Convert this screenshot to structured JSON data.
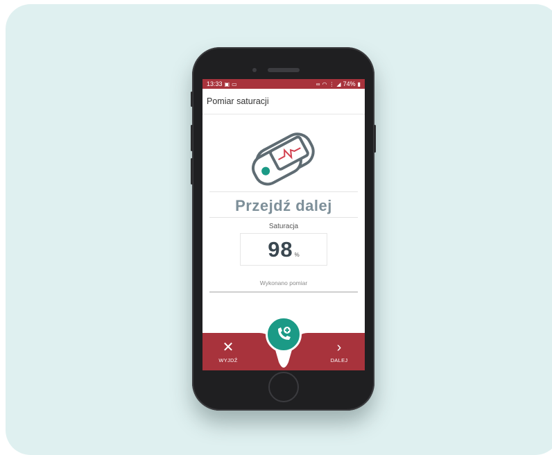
{
  "status_bar": {
    "time": "13:33",
    "icons_left": [
      "image-icon",
      "message-icon"
    ],
    "icons_right": [
      "link-icon",
      "wifi-icon",
      "lte-icon",
      "signal-icon"
    ],
    "battery": "74%"
  },
  "app_bar": {
    "title": "Pomiar saturacji"
  },
  "main": {
    "device_icon": "pulse-oximeter-icon",
    "next_title": "Przejdź dalej",
    "saturation_label": "Saturacja",
    "saturation_value": "98",
    "saturation_unit": "%",
    "status_text": "Wykonano pomiar"
  },
  "bottom_bar": {
    "exit_label": "WYJDŹ",
    "next_label": "DALEJ",
    "call_icon": "phone-plus-icon"
  },
  "colors": {
    "accent_red": "#a8333c",
    "accent_teal": "#1b9a86",
    "background": "#dff0f0"
  }
}
